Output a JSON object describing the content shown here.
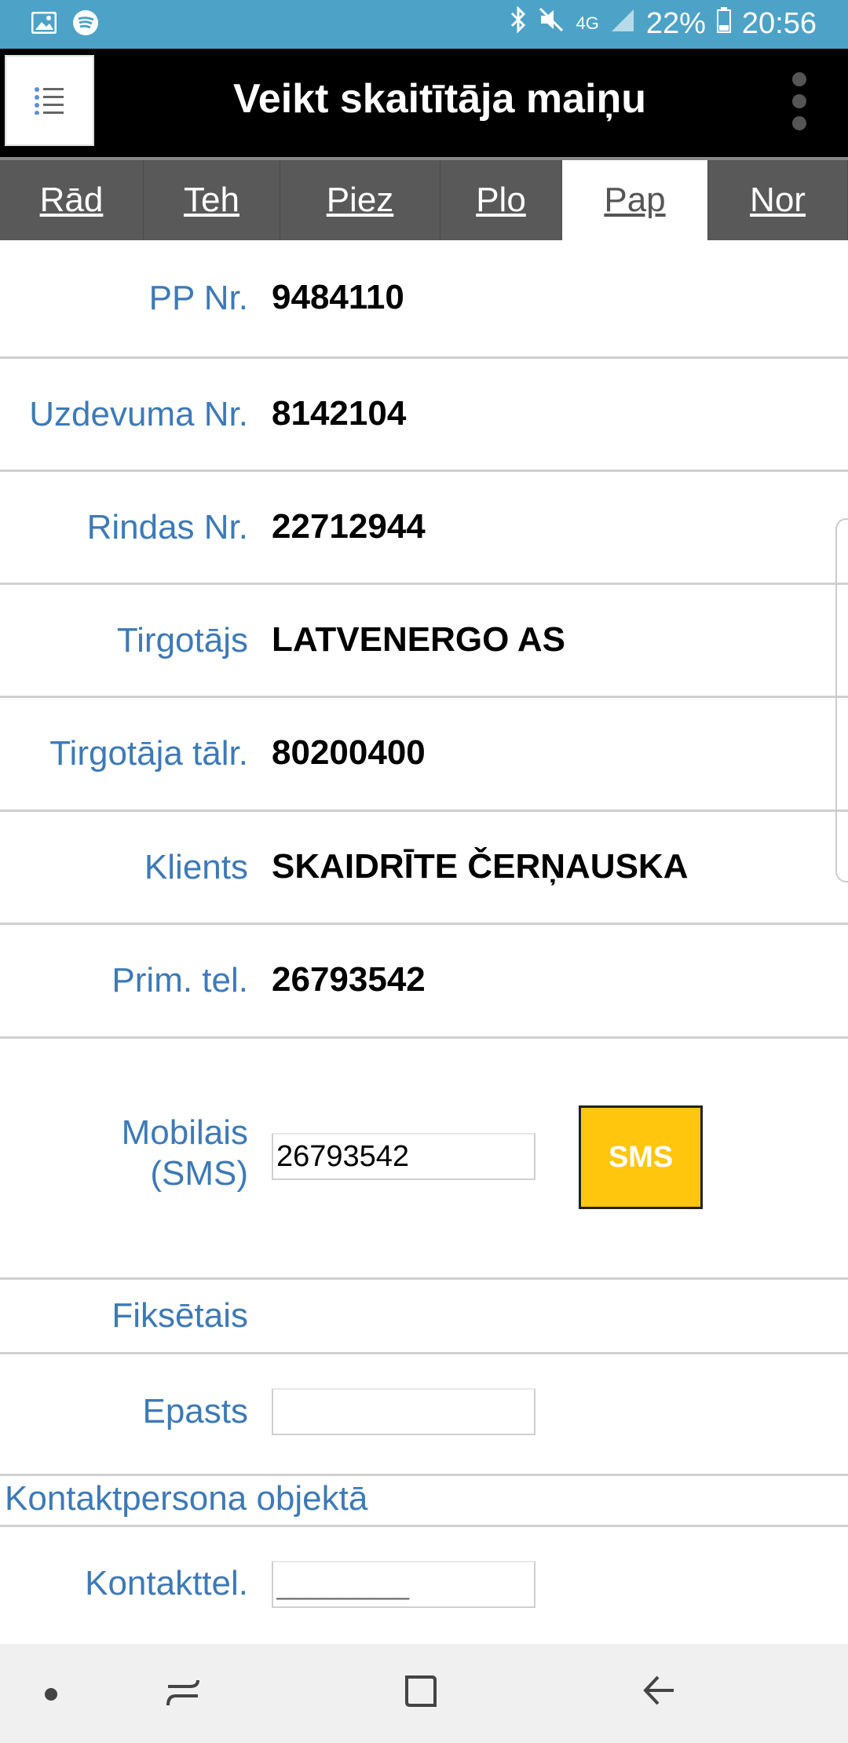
{
  "status_bar": {
    "battery": "22%",
    "time": "20:56",
    "network": "4G",
    "icons_left": [
      "image-icon",
      "spotify-icon"
    ],
    "icons_right": [
      "bluetooth-icon",
      "mute-icon",
      "signal-icon",
      "battery-icon"
    ]
  },
  "app_bar": {
    "title": "Veikt skaitītāja maiņu"
  },
  "tabs": [
    {
      "label": "Rād",
      "active": false
    },
    {
      "label": "Teh",
      "active": false
    },
    {
      "label": "Piez",
      "active": false
    },
    {
      "label": "Plo",
      "active": false
    },
    {
      "label": "Pap",
      "active": true
    },
    {
      "label": "Nor",
      "active": false
    }
  ],
  "fields": {
    "pp_nr": {
      "label": "PP Nr.",
      "value": "9484110"
    },
    "uzdevuma_nr": {
      "label": "Uzdevuma Nr.",
      "value": "8142104"
    },
    "rindas_nr": {
      "label": "Rindas Nr.",
      "value": "22712944"
    },
    "tirgotajs": {
      "label": "Tirgotājs",
      "value": "LATVENERGO AS"
    },
    "tirgotaja_talr": {
      "label": "Tirgotāja tālr.",
      "value": "80200400"
    },
    "klients": {
      "label": "Klients",
      "value": "SKAIDRĪTE ČERŅAUSKA"
    },
    "prim_tel": {
      "label": "Prim. tel.",
      "value": "26793542"
    },
    "mobilais": {
      "label_line1": "Mobilais",
      "label_line2": "(SMS)",
      "value": "26793542",
      "button": "SMS"
    },
    "fiksetais": {
      "label": "Fiksētais"
    },
    "epasts": {
      "label": "Epasts",
      "value": ""
    },
    "kontaktpersona": {
      "heading": "Kontaktpersona objektā"
    },
    "kontakttel": {
      "label": "Kontakttel.",
      "placeholder": "________"
    }
  },
  "colors": {
    "status_bar": "#4da3c7",
    "app_bar": "#000000",
    "tab_bar": "#595959",
    "label": "#3d7ab8",
    "sms_button": "#ffc60d"
  }
}
